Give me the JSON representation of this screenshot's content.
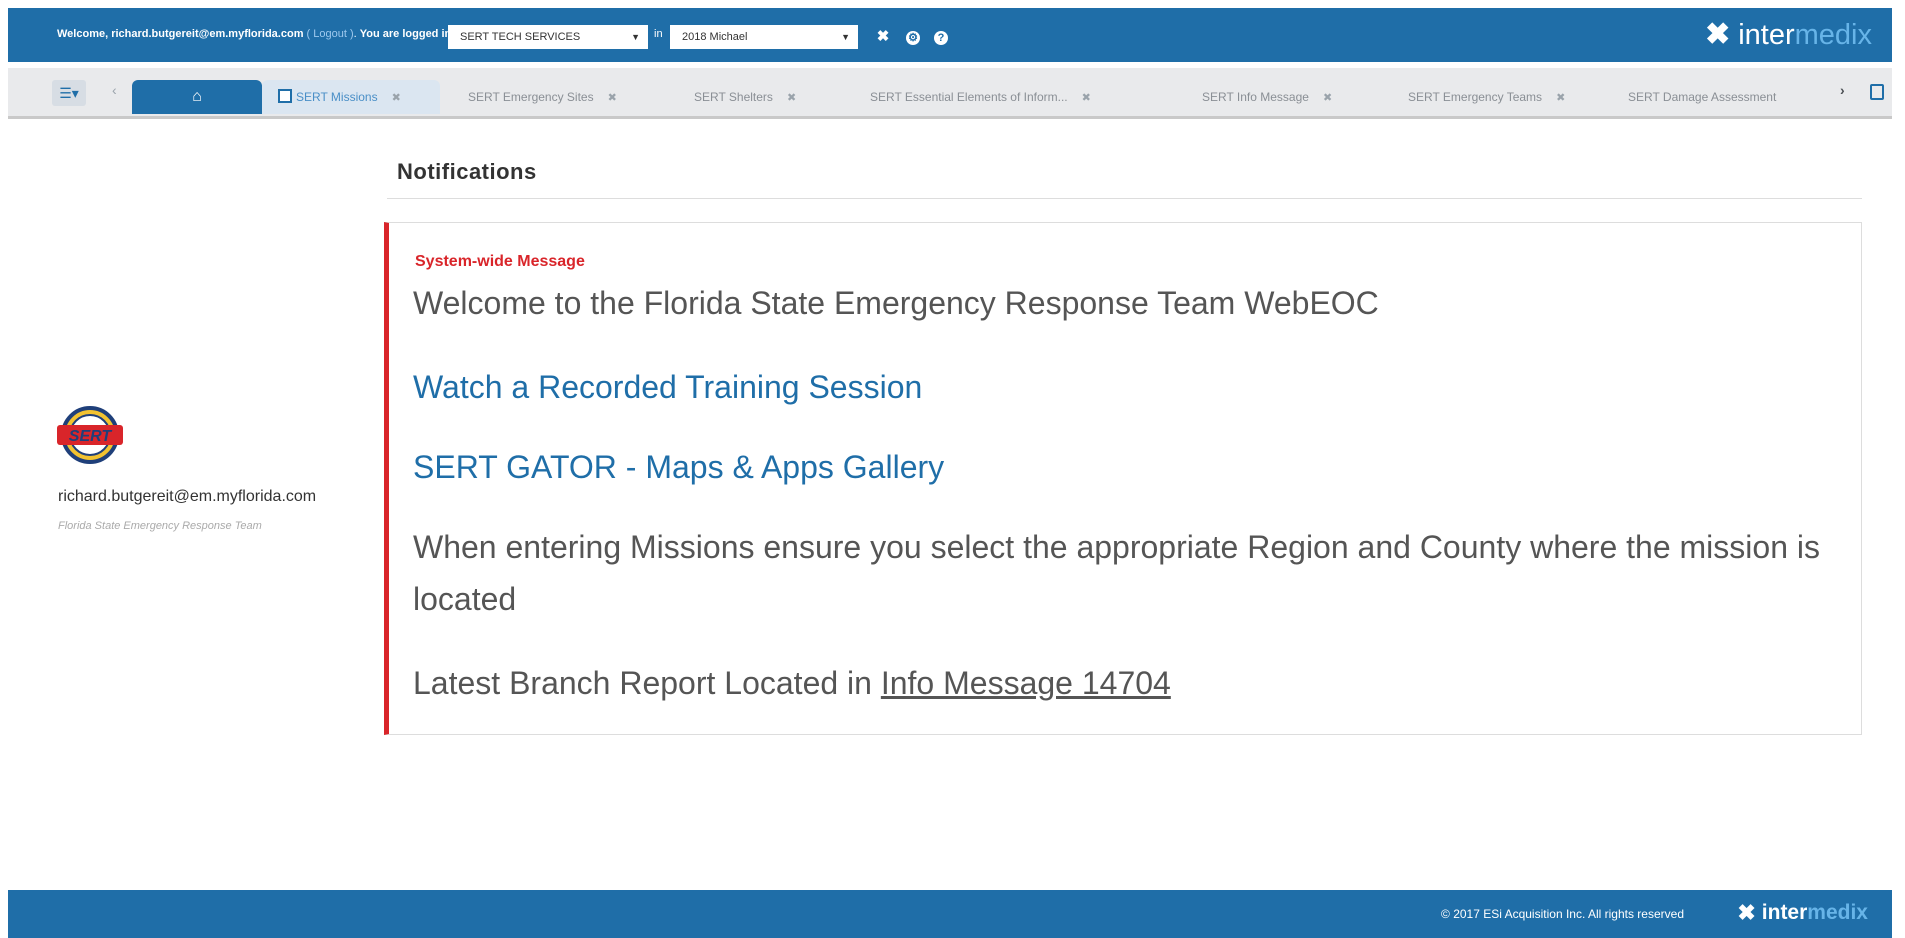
{
  "topbar": {
    "welcome_prefix": "Welcome, richard.butgereit@em.myflorida.com",
    "logout_label": "( Logout )",
    "logged_in_as": "You are logged in as",
    "position_value": "SERT TECH SERVICES",
    "in_label": "in",
    "incident_value": "2018 Michael",
    "brand_word1": "inter",
    "brand_word2": "medix"
  },
  "tabs": [
    {
      "label": "SERT Missions",
      "active": true
    },
    {
      "label": "SERT Emergency Sites"
    },
    {
      "label": "SERT Shelters"
    },
    {
      "label": "SERT Essential Elements of Inform..."
    },
    {
      "label": "SERT Info Message"
    },
    {
      "label": "SERT Emergency Teams"
    },
    {
      "label": "SERT Damage Assessment"
    }
  ],
  "profile": {
    "logo_text": "SERT",
    "email": "richard.butgereit@em.myflorida.com",
    "team": "Florida State Emergency Response Team"
  },
  "notifications": {
    "title": "Notifications",
    "system_label": "System-wide Message",
    "welcome": "Welcome to the Florida State Emergency Response Team WebEOC",
    "link_training": "Watch a Recorded Training Session",
    "link_gator": "SERT GATOR - Maps & Apps Gallery",
    "missions_note": "When entering Missions ensure you select the appropriate Region and County where the mission is located",
    "branch_prefix": "Latest Branch Report Located in",
    "branch_link": "Info Message 14704"
  },
  "footer": {
    "copyright": "© 2017 ESi Acquisition Inc. All rights reserved",
    "brand_word1": "inter",
    "brand_word2": "medix"
  },
  "colors": {
    "brand_blue": "#1f6ea8",
    "accent_red": "#d9252a",
    "brand_light": "#67b4e8"
  }
}
